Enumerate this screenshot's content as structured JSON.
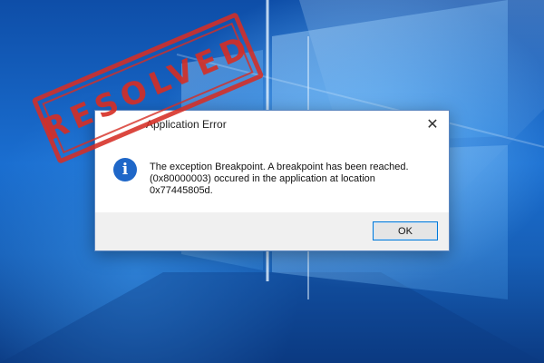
{
  "dialog": {
    "title": "Application Error",
    "close_glyph": "✕",
    "icon": "info-icon",
    "message_lines": [
      "The exception Breakpoint. A breakpoint has been reached.",
      "(0x80000003) occured in the application at location",
      "0x77445805d."
    ],
    "ok_label": "OK"
  },
  "stamp": {
    "text": "RESOLVED",
    "color": "#d62e24"
  },
  "colors": {
    "accent": "#0078d7",
    "info_icon": "#1f67c8"
  }
}
